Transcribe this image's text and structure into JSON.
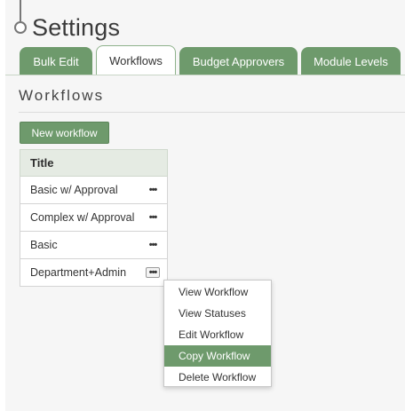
{
  "page": {
    "title": "Settings"
  },
  "tabs": [
    {
      "label": "Bulk Edit",
      "active": false
    },
    {
      "label": "Workflows",
      "active": true
    },
    {
      "label": "Budget Approvers",
      "active": false
    },
    {
      "label": "Module Levels",
      "active": false
    }
  ],
  "section": {
    "heading": "Workflows"
  },
  "toolbar": {
    "new_workflow_label": "New workflow"
  },
  "table": {
    "header": "Title",
    "rows": [
      {
        "title": "Basic w/ Approval",
        "menu_icon": "ellipsis-icon"
      },
      {
        "title": "Complex w/ Approval",
        "menu_icon": "ellipsis-icon"
      },
      {
        "title": "Basic",
        "menu_icon": "ellipsis-icon"
      },
      {
        "title": "Department+Admin",
        "menu_icon": "ellipsis-icon"
      }
    ]
  },
  "context_menu": {
    "items": [
      {
        "label": "View Workflow"
      },
      {
        "label": "View Statuses"
      },
      {
        "label": "Edit Workflow"
      },
      {
        "label": "Copy Workflow",
        "highlighted": true
      },
      {
        "label": "Delete Workflow"
      }
    ]
  },
  "colors": {
    "accent": "#6e9a6c",
    "header_bg": "#e5ebe3",
    "panel_bg": "#f6f6f6"
  }
}
